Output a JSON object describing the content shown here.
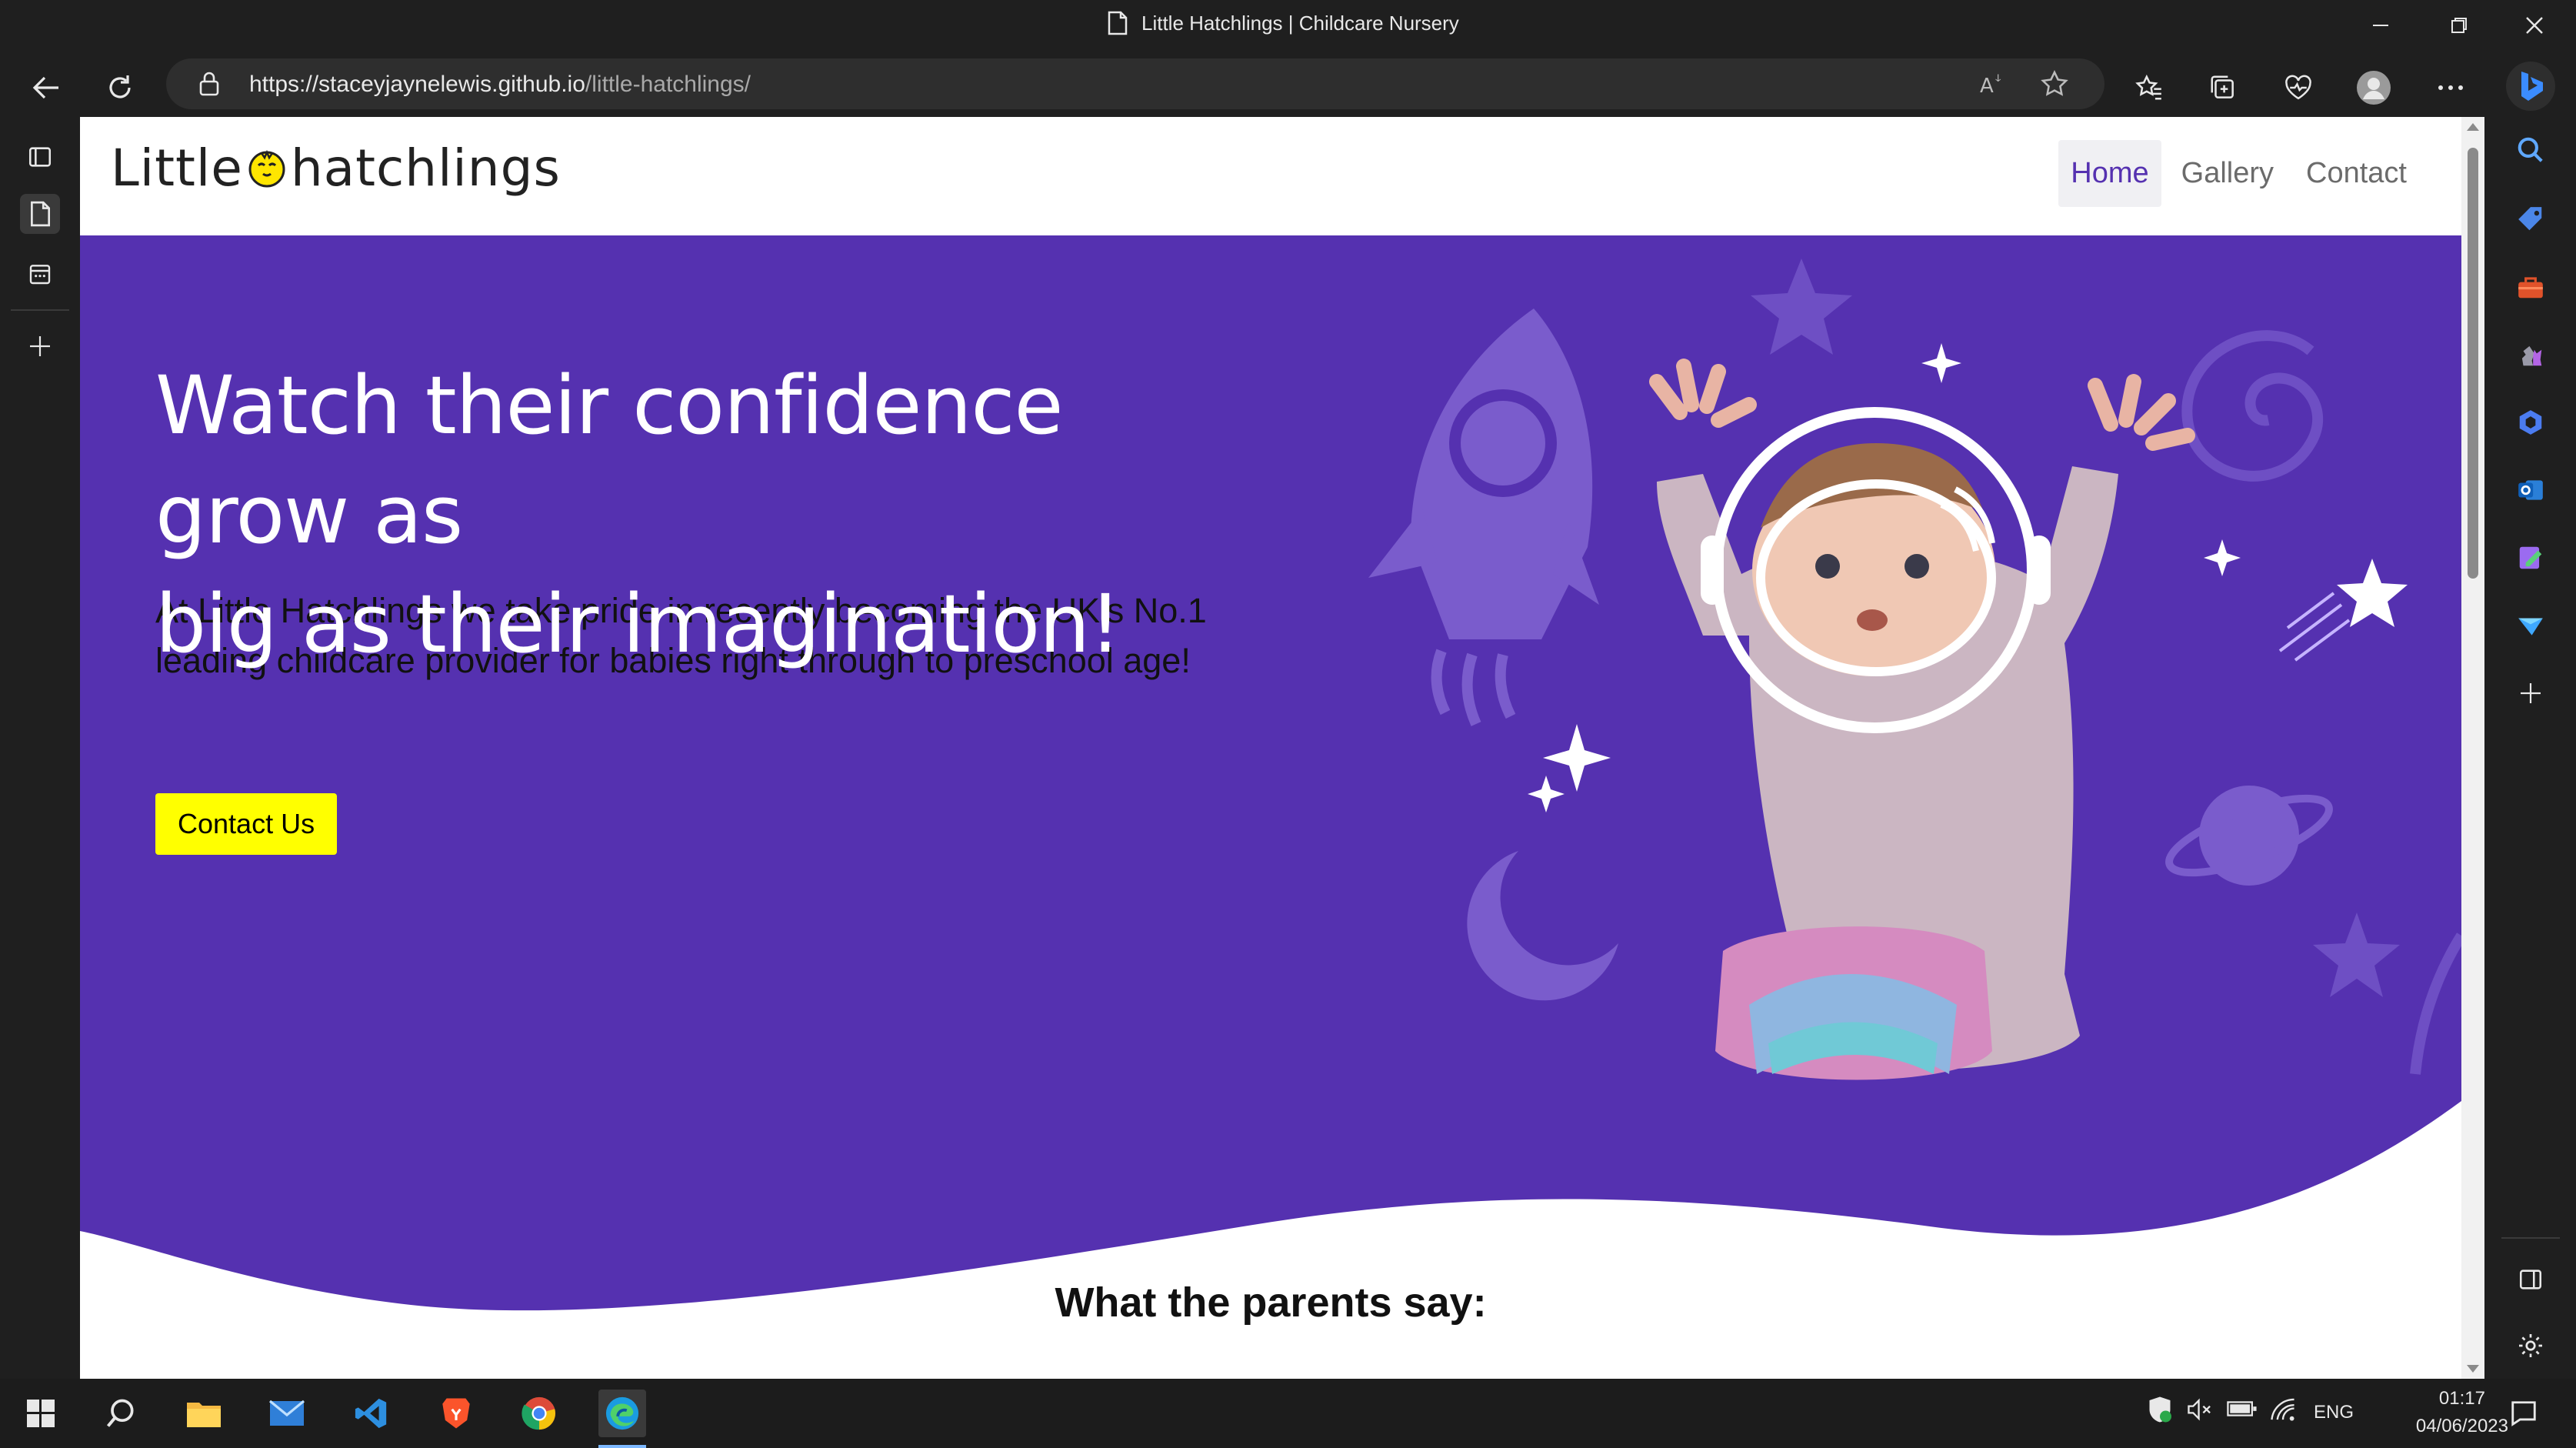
{
  "browser": {
    "tab_title": "Little Hatchlings | Childcare Nursery",
    "url_host": "https://staceyjaynelewis.github.io",
    "url_path": "/little-hatchlings/"
  },
  "site": {
    "logo_left": "Little",
    "logo_right": "hatchlings",
    "nav": [
      "Home",
      "Gallery",
      "Contact"
    ],
    "active_nav": "Home",
    "headline": {
      "line1_a": "Watch their",
      "line1_hl": "confidence",
      "line1_b": "grow as",
      "line2_hl": "big",
      "line2_b": "as their imagination!"
    },
    "intro": "At Little Hatchlings we take pride in recently becoming the UK's No.1 leading childcare provider for babies right through to preschool age!",
    "cta": "Contact Us",
    "parents_heading": "What the parents say:"
  },
  "taskbar": {
    "language": "ENG",
    "time": "01:17",
    "date": "04/06/2023"
  },
  "colors": {
    "hero_purple": "#5531b0",
    "accent_yellow": "#ffed00",
    "button_yellow": "#ffff00"
  },
  "icons": [
    "back-icon",
    "refresh-icon",
    "lock-icon",
    "read-aloud-icon",
    "star-icon",
    "favorites-icon",
    "collections-icon",
    "health-icon",
    "profile-icon",
    "more-icon",
    "bing-icon"
  ]
}
